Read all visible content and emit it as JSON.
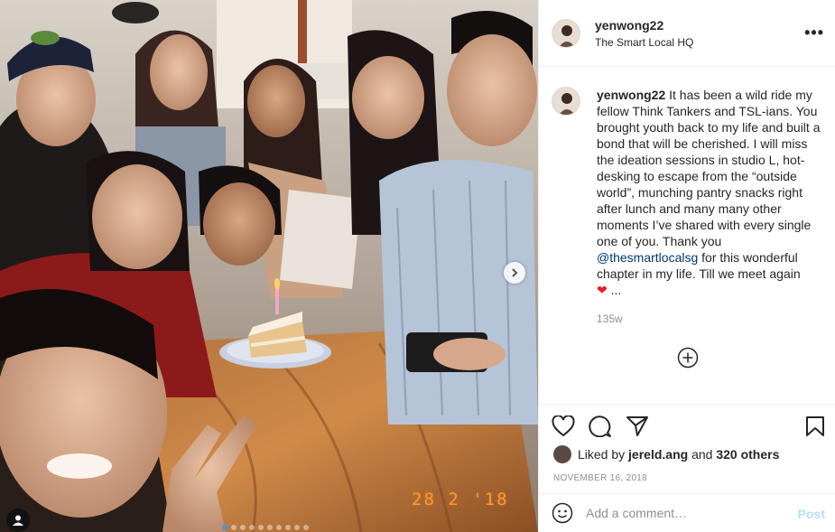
{
  "post": {
    "username": "yenwong22",
    "location": "The Smart Local HQ",
    "more_label": "•••"
  },
  "caption": {
    "username": "yenwong22",
    "text_before_mention": " It has been a wild ride my fellow Think Tankers and TSL-ians. You brought youth back to my life and built a bond that will be cherished. I will miss the ideation sessions in studio L, hot-desking to escape from the “outside world”, munching pantry snacks right after lunch and many many other moments I’ve shared with every single one of you. Thank you ",
    "mention": "@thesmartlocalsg",
    "text_after_mention": " for this wonderful chapter in my life. Till we meet again ",
    "heart": "❤",
    "ellipsis": "...",
    "time_ago": "135w"
  },
  "photo": {
    "date_stamp": "28 2 '18",
    "carousel_total": 10,
    "carousel_active": 1
  },
  "likes": {
    "prefix": "Liked by ",
    "liker": "jereld.ang",
    "middle": " and ",
    "others": "320 others"
  },
  "date": "NOVEMBER 16, 2018",
  "comment": {
    "placeholder": "Add a comment…",
    "post_label": "Post"
  },
  "icons": {
    "like": "heart-outline-icon",
    "comment": "comment-bubble-icon",
    "share": "paper-plane-icon",
    "save": "bookmark-icon",
    "emoji": "smiley-icon",
    "load_more": "plus-circle-icon",
    "next": "chevron-right-icon",
    "tag": "user-tag-icon"
  }
}
